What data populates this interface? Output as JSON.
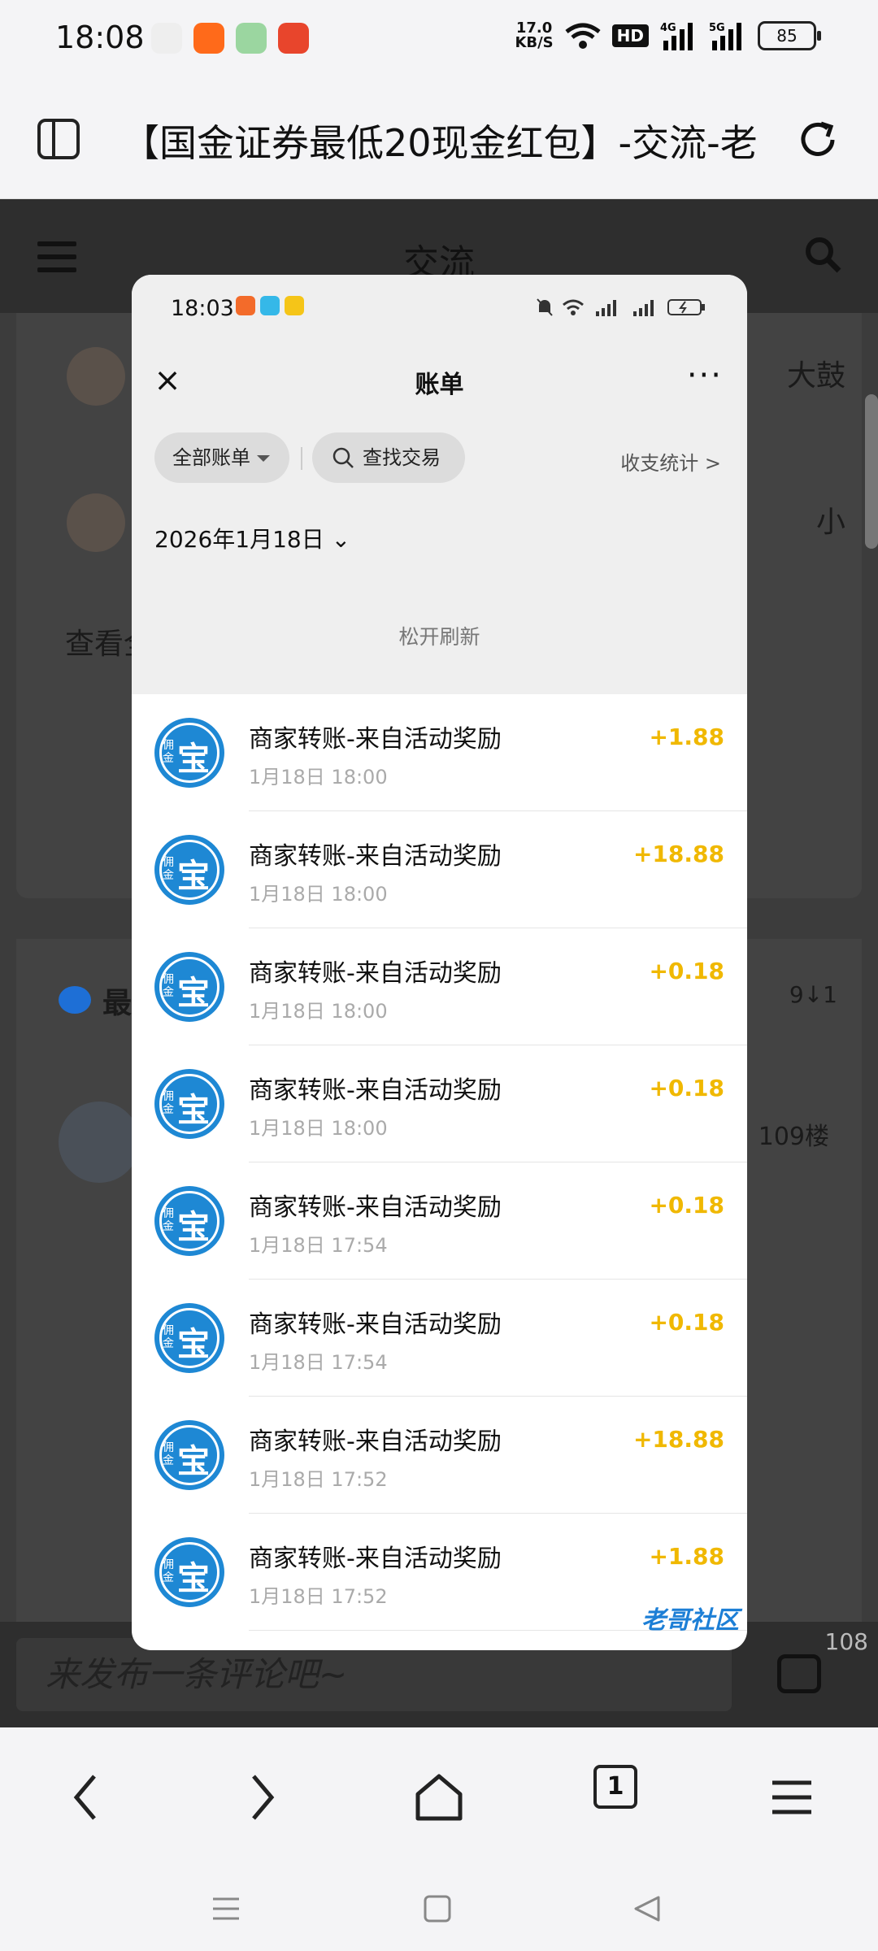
{
  "status": {
    "time": "18:08",
    "speed_top": "17.0",
    "speed_unit": "KB/S",
    "hd": "HD",
    "net1": "4G",
    "net2": "5G",
    "battery": "85"
  },
  "browser": {
    "title": "【国金证券最低20现金红包】-交流-老",
    "tabs_count": "1"
  },
  "page": {
    "header_title": "交流",
    "bg_text_1": "大鼓",
    "bg_text_2": "小",
    "see_more": "查看全",
    "section_title": "最",
    "sort": "9↓1",
    "floor": "109楼",
    "comment_placeholder": "来发布一条评论吧~",
    "comment_count": "108"
  },
  "overlay": {
    "time": "18:03",
    "nav_title": "账单",
    "more": "···",
    "filter_all": "全部账单",
    "search": "查找交易",
    "stats": "收支统计 >",
    "date": "2026年1月18日 ⌄",
    "release": "松开刷新",
    "watermark": "老哥社区",
    "rows": [
      {
        "title": "商家转账-来自活动奖励",
        "time": "1月18日 18:00",
        "amount": "+1.88"
      },
      {
        "title": "商家转账-来自活动奖励",
        "time": "1月18日 18:00",
        "amount": "+18.88"
      },
      {
        "title": "商家转账-来自活动奖励",
        "time": "1月18日 18:00",
        "amount": "+0.18"
      },
      {
        "title": "商家转账-来自活动奖励",
        "time": "1月18日 18:00",
        "amount": "+0.18"
      },
      {
        "title": "商家转账-来自活动奖励",
        "time": "1月18日 17:54",
        "amount": "+0.18"
      },
      {
        "title": "商家转账-来自活动奖励",
        "time": "1月18日 17:54",
        "amount": "+0.18"
      },
      {
        "title": "商家转账-来自活动奖励",
        "time": "1月18日 17:52",
        "amount": "+18.88"
      },
      {
        "title": "商家转账-来自活动奖励",
        "time": "1月18日 17:52",
        "amount": "+1.88"
      }
    ],
    "logo_text": "宝",
    "logo_small": "佣金"
  },
  "colors": {
    "amount": "#f0b800",
    "logo": "#1e88d4",
    "dim": "#3c3c3c"
  }
}
